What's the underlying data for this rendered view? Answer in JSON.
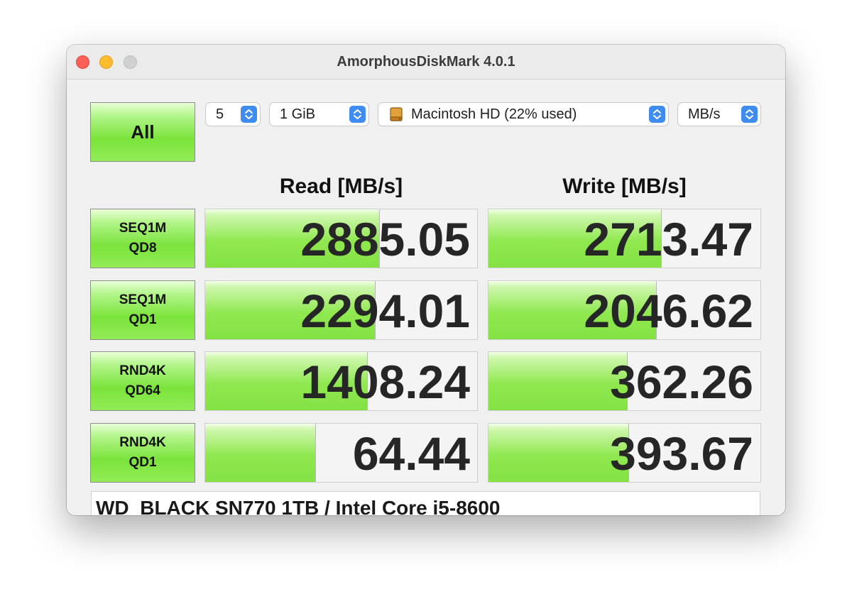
{
  "window": {
    "title": "AmorphousDiskMark 4.0.1"
  },
  "controls": {
    "all_label": "All",
    "count": "5",
    "size": "1 GiB",
    "disk": "Macintosh HD (22% used)",
    "disk_icon": "hard-drive-icon",
    "unit": "MB/s"
  },
  "headers": {
    "read": "Read [MB/s]",
    "write": "Write [MB/s]"
  },
  "colors": {
    "bar_green": "#84e244",
    "select_arrow_blue": "#3f8cf0",
    "close": "#fe5f57",
    "minimize": "#febc2e"
  },
  "tests": [
    {
      "label": "SEQ1M\nQD8",
      "read": "2885.05",
      "read_fill": 0.64,
      "write": "2713.47",
      "write_fill": 0.635
    },
    {
      "label": "SEQ1M\nQD1",
      "read": "2294.01",
      "read_fill": 0.625,
      "write": "2046.62",
      "write_fill": 0.615
    },
    {
      "label": "RND4K\nQD64",
      "read": "1408.24",
      "read_fill": 0.595,
      "write": "362.26",
      "write_fill": 0.51
    },
    {
      "label": "RND4K\nQD1",
      "read": "64.44",
      "read_fill": 0.405,
      "write": "393.67",
      "write_fill": 0.515
    }
  ],
  "comment": "WD_BLACK SN770 1TB / Intel Core i5-8600"
}
